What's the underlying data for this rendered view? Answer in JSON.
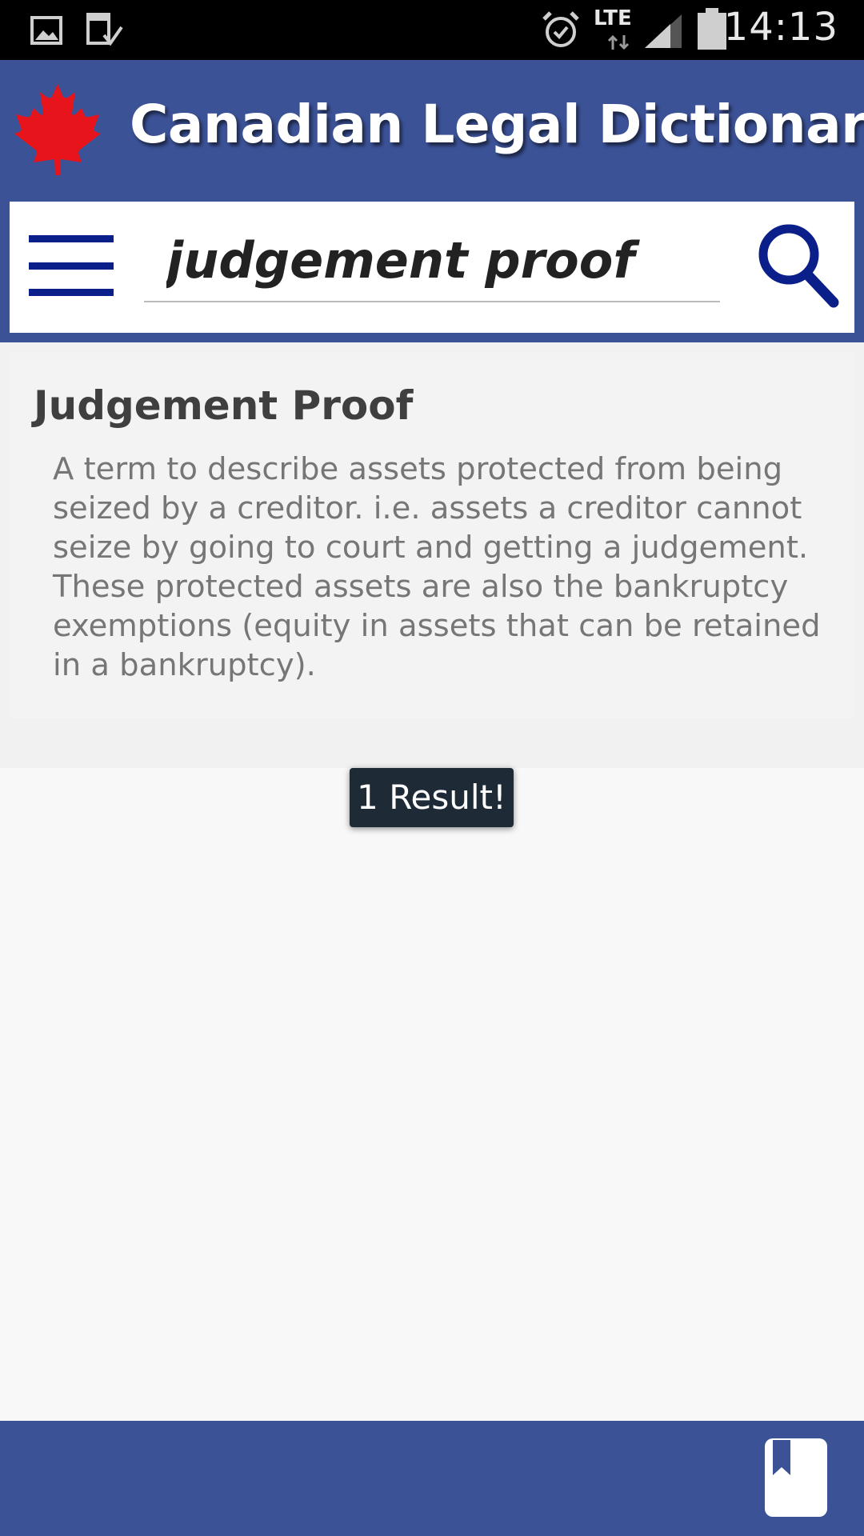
{
  "status_bar": {
    "time": "14:13",
    "network": "LTE",
    "icons": [
      "image-notification-icon",
      "download-complete-icon",
      "alarm-icon",
      "lte-icon",
      "signal-icon",
      "battery-icon"
    ]
  },
  "header": {
    "title": "Canadian Legal Dictionary",
    "logo": "maple-leaf-icon"
  },
  "search": {
    "value": "judgement proof",
    "menu_icon": "hamburger-menu-icon",
    "search_icon": "search-icon"
  },
  "result": {
    "term": "Judgement Proof",
    "definition": "A term to describe assets protected from being seized by a creditor. i.e. assets a creditor cannot seize by going to court and getting a judgement. These protected assets are also the bankruptcy exemptions (equity in assets that can be retained in a bankruptcy)."
  },
  "toast": {
    "text": "1 Result!"
  },
  "bottom_bar": {
    "bookmark_icon": "bookmark-icon"
  },
  "colors": {
    "header_bg": "#3c5297",
    "menu_icon": "#0b1f8a",
    "leaf": "#e8141b",
    "toast_bg": "#1e2b37"
  }
}
